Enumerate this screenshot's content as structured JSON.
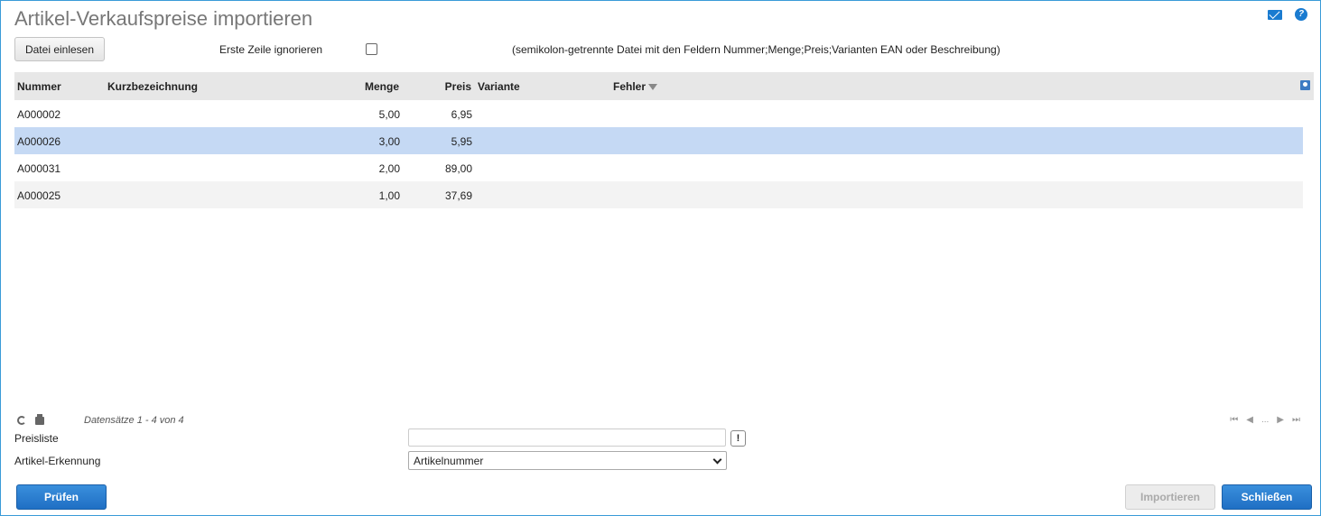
{
  "window": {
    "title": "Artikel-Verkaufspreise importieren"
  },
  "top_icons": [
    "mail-icon",
    "help-icon"
  ],
  "toolbar": {
    "file_button": "Datei einlesen",
    "first_row_label": "Erste Zeile ignorieren",
    "first_row_checked": false,
    "hint": "(semikolon-getrennte Datei mit den Feldern Nummer;Menge;Preis;Varianten EAN oder Beschreibung)"
  },
  "grid": {
    "columns": {
      "nummer": "Nummer",
      "kurz": "Kurzbezeichnung",
      "menge": "Menge",
      "preis": "Preis",
      "variante": "Variante",
      "fehler": "Fehler"
    },
    "rows": [
      {
        "nummer": "A000002",
        "kurz": "",
        "menge": "5,00",
        "preis": "6,95",
        "variante": "",
        "fehler": ""
      },
      {
        "nummer": "A000026",
        "kurz": "",
        "menge": "3,00",
        "preis": "5,95",
        "variante": "",
        "fehler": ""
      },
      {
        "nummer": "A000031",
        "kurz": "",
        "menge": "2,00",
        "preis": "89,00",
        "variante": "",
        "fehler": ""
      },
      {
        "nummer": "A000025",
        "kurz": "",
        "menge": "1,00",
        "preis": "37,69",
        "variante": "",
        "fehler": ""
      }
    ],
    "selected_row": 1,
    "records": "Datensätze 1 - 4 von 4",
    "pager": {
      "first": "⏮",
      "prev": "◀",
      "ellipsis": "...",
      "next": "▶",
      "last": "⏭"
    }
  },
  "form": {
    "preisliste_label": "Preisliste",
    "preisliste_value": "",
    "excl_button": "!",
    "erkennung_label": "Artikel-Erkennung",
    "erkennung_value": "Artikelnummer"
  },
  "actions": {
    "pruefen": "Prüfen",
    "importieren": "Importieren",
    "schliessen": "Schließen"
  },
  "colors": {
    "accent": "#1f6fc4",
    "selected_row": "#c5d9f4",
    "frame": "#3a9bd8"
  }
}
